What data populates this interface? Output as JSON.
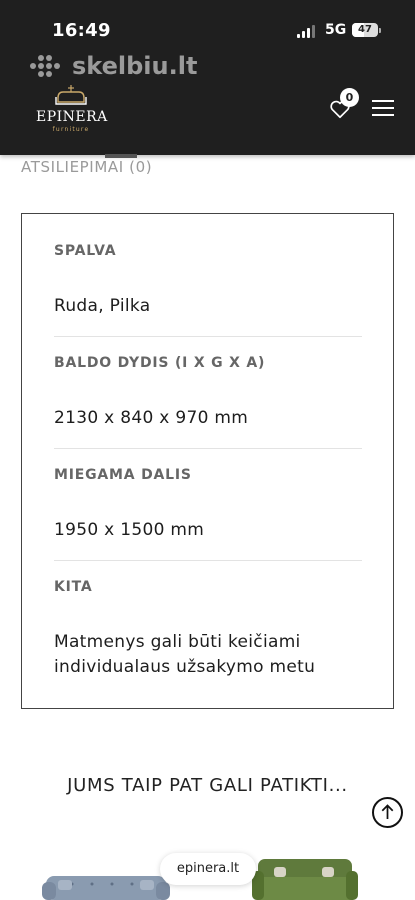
{
  "status_bar": {
    "time": "16:49",
    "network": "5G",
    "battery": "47",
    "battery_level": 0.47
  },
  "watermark": {
    "text": "skelbiu.lt"
  },
  "header": {
    "logo_name": "EPINERA",
    "logo_sub": "furniture",
    "wishlist_count": "0",
    "icons": [
      "heart-icon",
      "hamburger-menu-icon"
    ]
  },
  "tab": {
    "label": "ATSILIEPIMAI (0)"
  },
  "details": [
    {
      "label": "SPALVA",
      "value": "Ruda, Pilka"
    },
    {
      "label": "BALDO DYDIS (I X G X A)",
      "value": "2130 x 840 x 970 mm"
    },
    {
      "label": "MIEGAMA DALIS",
      "value": "1950 x 1500 mm"
    },
    {
      "label": "KITA",
      "value_line1": "Matmenys gali būti keičiami",
      "value_line2": "individualaus užsakymo metu"
    }
  ],
  "suggestions": {
    "title": "JUMS TAIP PAT GALI PATIKTI..."
  },
  "browser": {
    "url": "epinera.lt"
  },
  "colors": {
    "header_bg": "#1f1f1f",
    "accent_gold": "#c9a86a",
    "sofa_left": "#8a9bb0",
    "sofa_right": "#5f7a3c"
  }
}
